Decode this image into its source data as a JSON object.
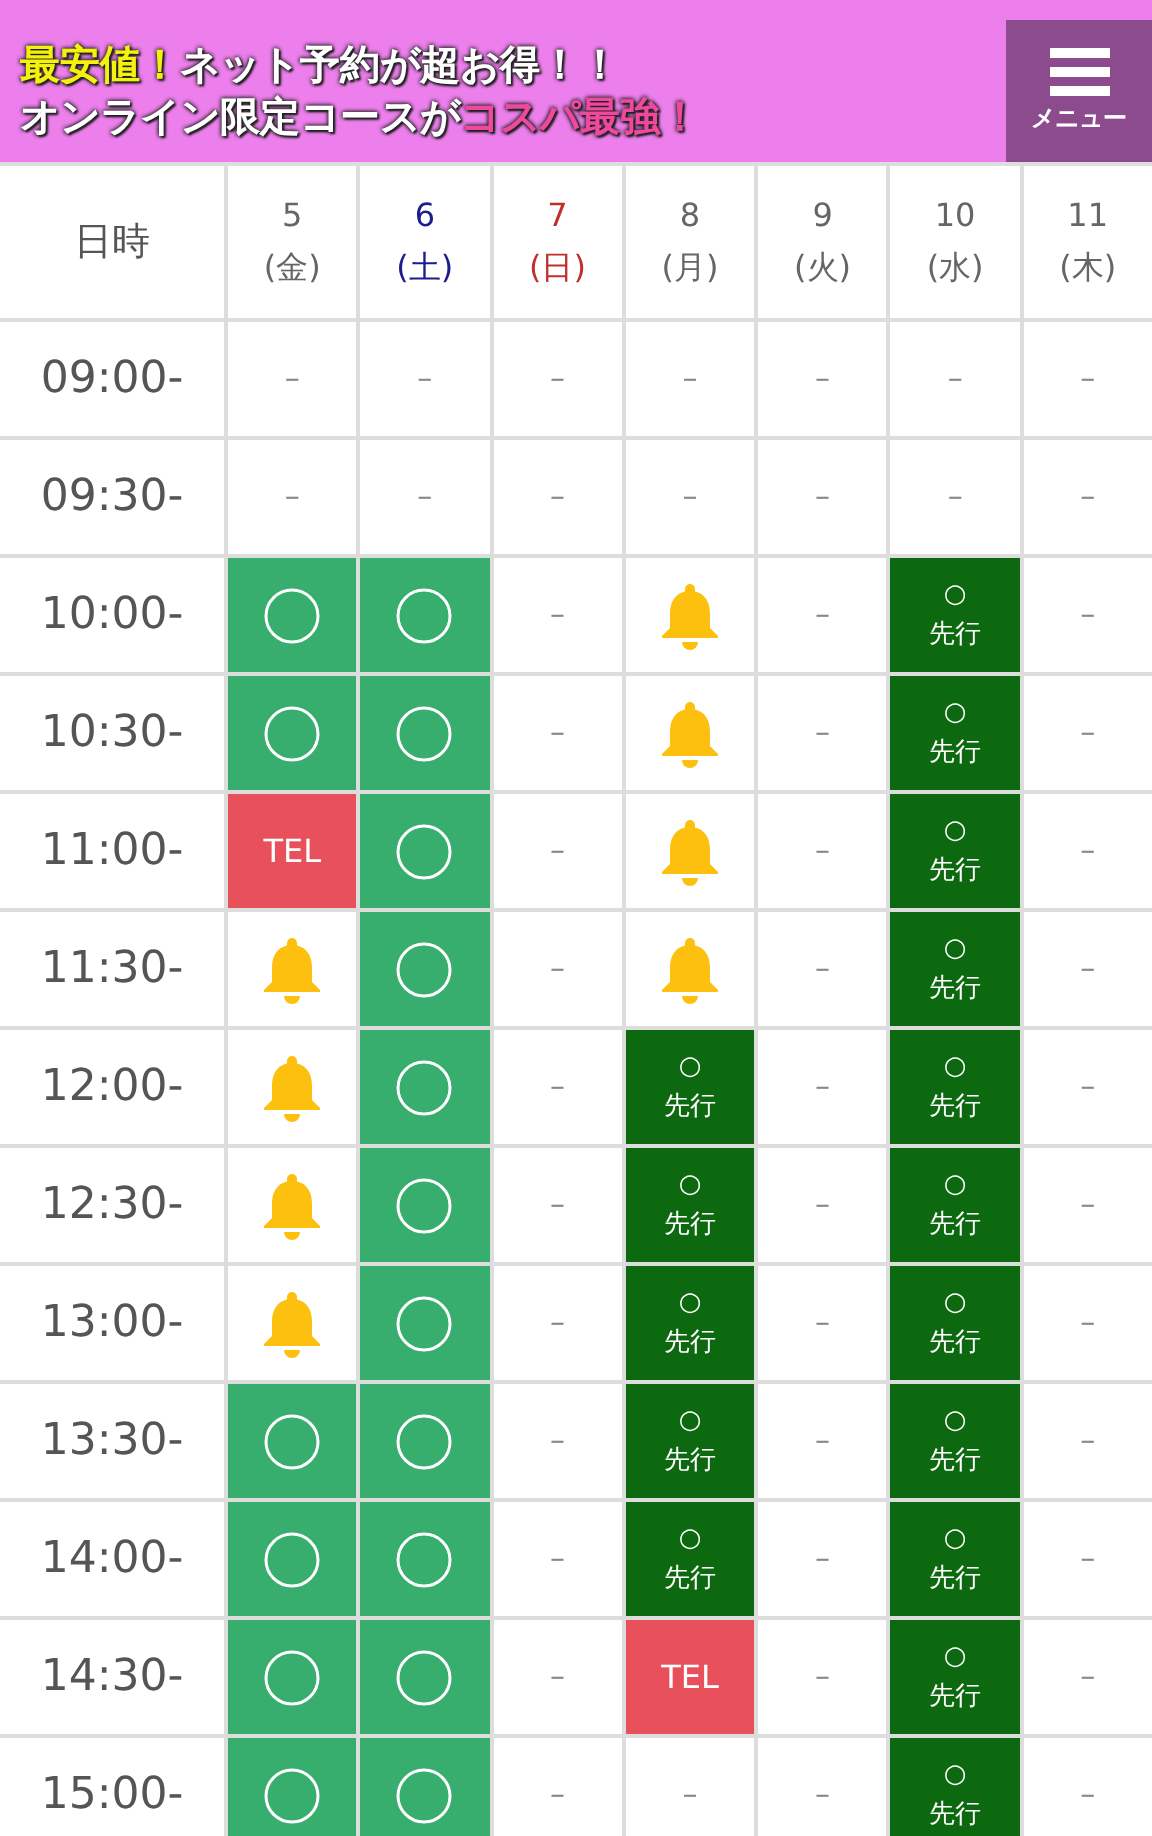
{
  "banner": {
    "lines": [
      [
        {
          "text": "最安値！",
          "kind": "yellow"
        },
        {
          "text": "ネット予約が超お得！！",
          "kind": "plain"
        }
      ],
      [
        {
          "text": "オンライン限定コースが",
          "kind": "plain"
        },
        {
          "text": "コスパ最強！",
          "kind": "pink"
        }
      ]
    ],
    "menu_button": {
      "label": "メニュー"
    }
  },
  "table": {
    "corner": "日時",
    "days": [
      {
        "date": "5",
        "weekday": "(金)",
        "kind": "weekday"
      },
      {
        "date": "6",
        "weekday": "(土)",
        "kind": "saturday"
      },
      {
        "date": "7",
        "weekday": "(日)",
        "kind": "sunday"
      },
      {
        "date": "8",
        "weekday": "(月)",
        "kind": "weekday"
      },
      {
        "date": "9",
        "weekday": "(火)",
        "kind": "weekday"
      },
      {
        "date": "10",
        "weekday": "(水)",
        "kind": "weekday"
      },
      {
        "date": "11",
        "weekday": "(木)",
        "kind": "weekday"
      }
    ],
    "rows": [
      {
        "time": "09:00-",
        "cells": [
          {
            "kind": "none",
            "text": "–"
          },
          {
            "kind": "none",
            "text": "–"
          },
          {
            "kind": "none",
            "text": "–"
          },
          {
            "kind": "none",
            "text": "–"
          },
          {
            "kind": "none",
            "text": "–"
          },
          {
            "kind": "none",
            "text": "–"
          },
          {
            "kind": "none",
            "text": "–"
          }
        ]
      },
      {
        "time": "09:30-",
        "cells": [
          {
            "kind": "none",
            "text": "–"
          },
          {
            "kind": "none",
            "text": "–"
          },
          {
            "kind": "none",
            "text": "–"
          },
          {
            "kind": "none",
            "text": "–"
          },
          {
            "kind": "none",
            "text": "–"
          },
          {
            "kind": "none",
            "text": "–"
          },
          {
            "kind": "none",
            "text": "–"
          }
        ]
      },
      {
        "time": "10:00-",
        "cells": [
          {
            "kind": "open"
          },
          {
            "kind": "open"
          },
          {
            "kind": "none",
            "text": "–"
          },
          {
            "kind": "bell"
          },
          {
            "kind": "none",
            "text": "–"
          },
          {
            "kind": "advance",
            "mark": "○",
            "text": "先行"
          },
          {
            "kind": "none",
            "text": "–"
          }
        ]
      },
      {
        "time": "10:30-",
        "cells": [
          {
            "kind": "open"
          },
          {
            "kind": "open"
          },
          {
            "kind": "none",
            "text": "–"
          },
          {
            "kind": "bell"
          },
          {
            "kind": "none",
            "text": "–"
          },
          {
            "kind": "advance",
            "mark": "○",
            "text": "先行"
          },
          {
            "kind": "none",
            "text": "–"
          }
        ]
      },
      {
        "time": "11:00-",
        "cells": [
          {
            "kind": "tel",
            "text": "TEL"
          },
          {
            "kind": "open"
          },
          {
            "kind": "none",
            "text": "–"
          },
          {
            "kind": "bell"
          },
          {
            "kind": "none",
            "text": "–"
          },
          {
            "kind": "advance",
            "mark": "○",
            "text": "先行"
          },
          {
            "kind": "none",
            "text": "–"
          }
        ]
      },
      {
        "time": "11:30-",
        "cells": [
          {
            "kind": "bell"
          },
          {
            "kind": "open"
          },
          {
            "kind": "none",
            "text": "–"
          },
          {
            "kind": "bell"
          },
          {
            "kind": "none",
            "text": "–"
          },
          {
            "kind": "advance",
            "mark": "○",
            "text": "先行"
          },
          {
            "kind": "none",
            "text": "–"
          }
        ]
      },
      {
        "time": "12:00-",
        "cells": [
          {
            "kind": "bell"
          },
          {
            "kind": "open"
          },
          {
            "kind": "none",
            "text": "–"
          },
          {
            "kind": "advance",
            "mark": "○",
            "text": "先行"
          },
          {
            "kind": "none",
            "text": "–"
          },
          {
            "kind": "advance",
            "mark": "○",
            "text": "先行"
          },
          {
            "kind": "none",
            "text": "–"
          }
        ]
      },
      {
        "time": "12:30-",
        "cells": [
          {
            "kind": "bell"
          },
          {
            "kind": "open"
          },
          {
            "kind": "none",
            "text": "–"
          },
          {
            "kind": "advance",
            "mark": "○",
            "text": "先行"
          },
          {
            "kind": "none",
            "text": "–"
          },
          {
            "kind": "advance",
            "mark": "○",
            "text": "先行"
          },
          {
            "kind": "none",
            "text": "–"
          }
        ]
      },
      {
        "time": "13:00-",
        "cells": [
          {
            "kind": "bell"
          },
          {
            "kind": "open"
          },
          {
            "kind": "none",
            "text": "–"
          },
          {
            "kind": "advance",
            "mark": "○",
            "text": "先行"
          },
          {
            "kind": "none",
            "text": "–"
          },
          {
            "kind": "advance",
            "mark": "○",
            "text": "先行"
          },
          {
            "kind": "none",
            "text": "–"
          }
        ]
      },
      {
        "time": "13:30-",
        "cells": [
          {
            "kind": "open"
          },
          {
            "kind": "open"
          },
          {
            "kind": "none",
            "text": "–"
          },
          {
            "kind": "advance",
            "mark": "○",
            "text": "先行"
          },
          {
            "kind": "none",
            "text": "–"
          },
          {
            "kind": "advance",
            "mark": "○",
            "text": "先行"
          },
          {
            "kind": "none",
            "text": "–"
          }
        ]
      },
      {
        "time": "14:00-",
        "cells": [
          {
            "kind": "open"
          },
          {
            "kind": "open"
          },
          {
            "kind": "none",
            "text": "–"
          },
          {
            "kind": "advance",
            "mark": "○",
            "text": "先行"
          },
          {
            "kind": "none",
            "text": "–"
          },
          {
            "kind": "advance",
            "mark": "○",
            "text": "先行"
          },
          {
            "kind": "none",
            "text": "–"
          }
        ]
      },
      {
        "time": "14:30-",
        "cells": [
          {
            "kind": "open"
          },
          {
            "kind": "open"
          },
          {
            "kind": "none",
            "text": "–"
          },
          {
            "kind": "tel",
            "text": "TEL"
          },
          {
            "kind": "none",
            "text": "–"
          },
          {
            "kind": "advance",
            "mark": "○",
            "text": "先行"
          },
          {
            "kind": "none",
            "text": "–"
          }
        ]
      },
      {
        "time": "15:00-",
        "cells": [
          {
            "kind": "open"
          },
          {
            "kind": "open"
          },
          {
            "kind": "none",
            "text": "–"
          },
          {
            "kind": "none",
            "text": "–"
          },
          {
            "kind": "none",
            "text": "–"
          },
          {
            "kind": "advance",
            "mark": "○",
            "text": "先行"
          },
          {
            "kind": "none",
            "text": "–"
          }
        ]
      }
    ]
  }
}
